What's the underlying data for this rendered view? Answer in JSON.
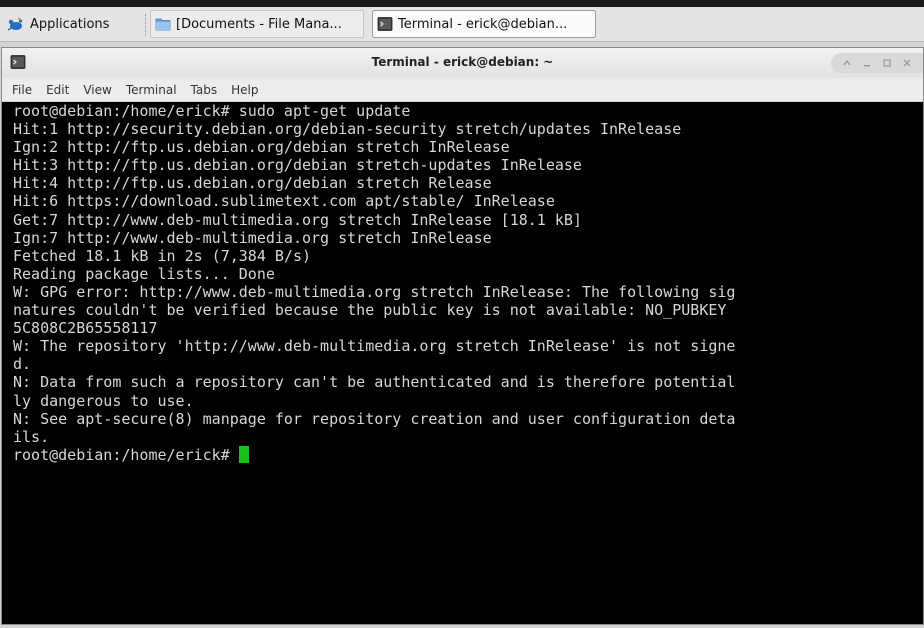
{
  "taskbar": {
    "items": [
      {
        "label": "Applications",
        "icon": "xfce-mouse-icon"
      },
      {
        "label": "[Documents - File Mana...",
        "icon": "folder-icon"
      },
      {
        "label": "Terminal - erick@debian...",
        "icon": "terminal-icon"
      }
    ]
  },
  "window": {
    "title": "Terminal - erick@debian: ~",
    "menu": [
      "File",
      "Edit",
      "View",
      "Terminal",
      "Tabs",
      "Help"
    ],
    "controls": [
      "sticky-icon",
      "minimize-icon",
      "maximize-icon",
      "close-icon"
    ]
  },
  "terminal": {
    "lines": [
      "root@debian:/home/erick# sudo apt-get update",
      "Hit:1 http://security.debian.org/debian-security stretch/updates InRelease",
      "Ign:2 http://ftp.us.debian.org/debian stretch InRelease",
      "Hit:3 http://ftp.us.debian.org/debian stretch-updates InRelease",
      "Hit:4 http://ftp.us.debian.org/debian stretch Release",
      "Hit:6 https://download.sublimetext.com apt/stable/ InRelease",
      "Get:7 http://www.deb-multimedia.org stretch InRelease [18.1 kB]",
      "Ign:7 http://www.deb-multimedia.org stretch InRelease",
      "Fetched 18.1 kB in 2s (7,384 B/s)",
      "Reading package lists... Done",
      "W: GPG error: http://www.deb-multimedia.org stretch InRelease: The following sig",
      "natures couldn't be verified because the public key is not available: NO_PUBKEY",
      "5C808C2B65558117",
      "W: The repository 'http://www.deb-multimedia.org stretch InRelease' is not signe",
      "d.",
      "N: Data from such a repository can't be authenticated and is therefore potential",
      "ly dangerous to use.",
      "N: See apt-secure(8) manpage for repository creation and user configuration deta",
      "ils."
    ],
    "prompt": "root@debian:/home/erick# ",
    "cursor_color": "#19c219"
  }
}
